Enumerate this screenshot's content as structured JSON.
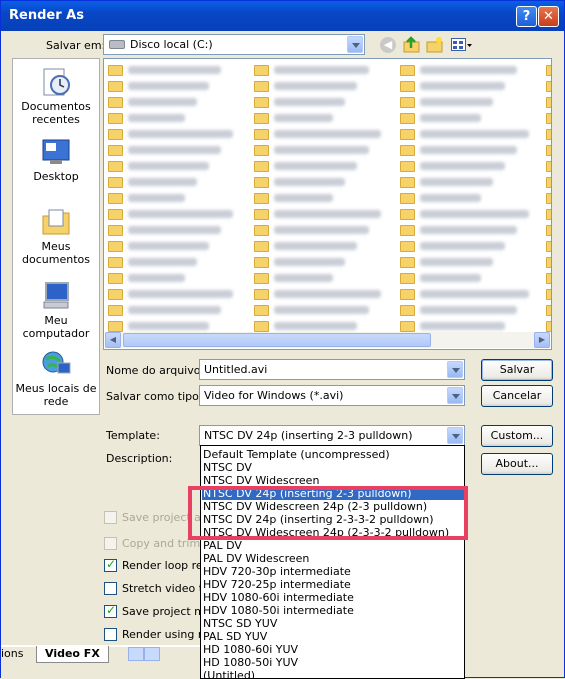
{
  "title": "Render As",
  "title_buttons": {
    "help": "?",
    "close": "✕"
  },
  "save_in": {
    "label": "Salvar em:",
    "value": "Disco local (C:)"
  },
  "places": [
    {
      "label": "Documentos recentes",
      "icon": "recent-documents-icon"
    },
    {
      "label": "Desktop",
      "icon": "desktop-icon"
    },
    {
      "label": "Meus documentos",
      "icon": "my-documents-icon"
    },
    {
      "label": "Meu computador",
      "icon": "my-computer-icon"
    },
    {
      "label": "Meus locais de rede",
      "icon": "network-places-icon"
    }
  ],
  "file_name": {
    "label": "Nome do arquivo:",
    "value": "Untitled.avi"
  },
  "save_as_type": {
    "label": "Salvar como tipo:",
    "value": "Video for Windows (*.avi)"
  },
  "buttons": {
    "save": "Salvar",
    "cancel": "Cancelar",
    "custom": "Custom...",
    "about": "About..."
  },
  "template": {
    "label": "Template:",
    "value": "NTSC DV 24p (inserting 2-3 pulldown)"
  },
  "description": {
    "label": "Description:"
  },
  "template_options": [
    "Default Template (uncompressed)",
    "NTSC DV",
    "NTSC DV Widescreen",
    "NTSC DV 24p (inserting 2-3 pulldown)",
    "NTSC DV Widescreen 24p (2-3 pulldown)",
    "NTSC DV 24p (inserting 2-3-3-2 pulldown)",
    "NTSC DV Widescreen 24p (2-3-3-2 pulldown)",
    "PAL DV",
    "PAL DV Widescreen",
    "HDV 720-30p intermediate",
    "HDV 720-25p intermediate",
    "HDV 1080-60i intermediate",
    "HDV 1080-50i intermediate",
    "NTSC SD YUV",
    "PAL SD YUV",
    "HD 1080-60i YUV",
    "HD 1080-50i YUV",
    "(Untitled)"
  ],
  "selected_option_index": 3,
  "checkboxes": [
    {
      "label": "Save project a",
      "checked": false,
      "enabled": false
    },
    {
      "label": "Copy and trim m",
      "checked": false,
      "enabled": false
    },
    {
      "label": "Render loop regi",
      "checked": true,
      "enabled": true
    },
    {
      "label": "Stretch video to",
      "checked": false,
      "enabled": true
    },
    {
      "label": "Save project mar",
      "checked": true,
      "enabled": true
    },
    {
      "label": "Render using net",
      "checked": false,
      "enabled": true
    }
  ],
  "background_tabs": {
    "left": "ions",
    "right": "Video FX"
  },
  "colors": {
    "titlebar": "#0847c6",
    "selection": "#316ac5",
    "highlight_box": "#e84060"
  }
}
